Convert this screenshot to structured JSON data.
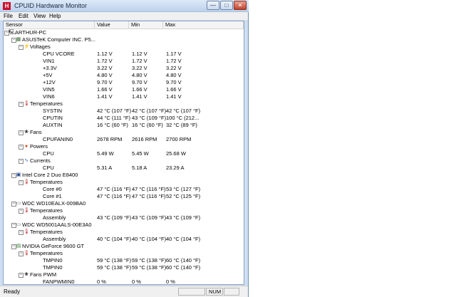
{
  "window": {
    "title": "CPUID Hardware Monitor",
    "app_icon": "H"
  },
  "menu": [
    "File",
    "Edit",
    "View",
    "Help"
  ],
  "columns": [
    "Sensor",
    "Value",
    "Min",
    "Max"
  ],
  "rows": [
    {
      "d": 0,
      "t": "pc",
      "l": "ARTHUR-PC",
      "v": "",
      "n": "",
      "x": ""
    },
    {
      "d": 1,
      "t": "mb",
      "l": "ASUSTeK Computer INC. P5...",
      "v": "",
      "n": "",
      "x": ""
    },
    {
      "d": 2,
      "t": "volt",
      "l": "Voltages",
      "v": "",
      "n": "",
      "x": ""
    },
    {
      "d": 3,
      "t": "",
      "l": "CPU VCORE",
      "v": "1.12 V",
      "n": "1.12 V",
      "x": "1.17 V"
    },
    {
      "d": 3,
      "t": "",
      "l": "VIN1",
      "v": "1.72 V",
      "n": "1.72 V",
      "x": "1.72 V"
    },
    {
      "d": 3,
      "t": "",
      "l": "+3.3V",
      "v": "3.22 V",
      "n": "3.22 V",
      "x": "3.22 V"
    },
    {
      "d": 3,
      "t": "",
      "l": "+5V",
      "v": "4.80 V",
      "n": "4.80 V",
      "x": "4.80 V"
    },
    {
      "d": 3,
      "t": "",
      "l": "+12V",
      "v": "9.70 V",
      "n": "9.70 V",
      "x": "9.70 V"
    },
    {
      "d": 3,
      "t": "",
      "l": "VIN5",
      "v": "1.66 V",
      "n": "1.66 V",
      "x": "1.66 V"
    },
    {
      "d": 3,
      "t": "",
      "l": "VIN6",
      "v": "1.41 V",
      "n": "1.41 V",
      "x": "1.41 V"
    },
    {
      "d": 2,
      "t": "temp",
      "l": "Temperatures",
      "v": "",
      "n": "",
      "x": ""
    },
    {
      "d": 3,
      "t": "",
      "l": "SYSTIN",
      "v": "42 °C  (107 °F)",
      "n": "42 °C  (107 °F)",
      "x": "42 °C  (107 °F)"
    },
    {
      "d": 3,
      "t": "",
      "l": "CPUTIN",
      "v": "44 °C  (111 °F)",
      "n": "43 °C  (109 °F)",
      "x": "100 °C  (212..."
    },
    {
      "d": 3,
      "t": "",
      "l": "AUXTIN",
      "v": "16 °C  (60 °F)",
      "n": "16 °C  (60 °F)",
      "x": "32 °C  (89 °F)"
    },
    {
      "d": 2,
      "t": "fan",
      "l": "Fans",
      "v": "",
      "n": "",
      "x": ""
    },
    {
      "d": 3,
      "t": "",
      "l": "CPUFANIN0",
      "v": "2678 RPM",
      "n": "2616 RPM",
      "x": "2700 RPM"
    },
    {
      "d": 2,
      "t": "power",
      "l": "Powers",
      "v": "",
      "n": "",
      "x": ""
    },
    {
      "d": 3,
      "t": "",
      "l": "CPU",
      "v": "5.49 W",
      "n": "5.45 W",
      "x": "25.68 W"
    },
    {
      "d": 2,
      "t": "curr",
      "l": "Currents",
      "v": "",
      "n": "",
      "x": ""
    },
    {
      "d": 3,
      "t": "",
      "l": "CPU",
      "v": "5.31 A",
      "n": "5.18 A",
      "x": "23.29 A"
    },
    {
      "d": 1,
      "t": "cpu",
      "l": "Intel Core 2 Duo E8400",
      "v": "",
      "n": "",
      "x": ""
    },
    {
      "d": 2,
      "t": "temp",
      "l": "Temperatures",
      "v": "",
      "n": "",
      "x": ""
    },
    {
      "d": 3,
      "t": "",
      "l": "Core #0",
      "v": "47 °C  (116 °F)",
      "n": "47 °C  (116 °F)",
      "x": "53 °C  (127 °F)"
    },
    {
      "d": 3,
      "t": "",
      "l": "Core #1",
      "v": "47 °C  (116 °F)",
      "n": "47 °C  (116 °F)",
      "x": "52 °C  (125 °F)"
    },
    {
      "d": 1,
      "t": "hdd",
      "l": "WDC WD10EALX-009BA0",
      "v": "",
      "n": "",
      "x": ""
    },
    {
      "d": 2,
      "t": "temp",
      "l": "Temperatures",
      "v": "",
      "n": "",
      "x": ""
    },
    {
      "d": 3,
      "t": "",
      "l": "Assembly",
      "v": "43 °C  (109 °F)",
      "n": "43 °C  (109 °F)",
      "x": "43 °C  (109 °F)"
    },
    {
      "d": 1,
      "t": "hdd",
      "l": "WDC WD5001AALS-00E3A0",
      "v": "",
      "n": "",
      "x": ""
    },
    {
      "d": 2,
      "t": "temp",
      "l": "Temperatures",
      "v": "",
      "n": "",
      "x": ""
    },
    {
      "d": 3,
      "t": "",
      "l": "Assembly",
      "v": "40 °C  (104 °F)",
      "n": "40 °C  (104 °F)",
      "x": "40 °C  (104 °F)"
    },
    {
      "d": 1,
      "t": "gpu",
      "l": "NVIDIA GeForce 9600 GT",
      "v": "",
      "n": "",
      "x": ""
    },
    {
      "d": 2,
      "t": "temp",
      "l": "Temperatures",
      "v": "",
      "n": "",
      "x": ""
    },
    {
      "d": 3,
      "t": "",
      "l": "TMPIN0",
      "v": "59 °C  (138 °F)",
      "n": "59 °C  (138 °F)",
      "x": "60 °C  (140 °F)"
    },
    {
      "d": 3,
      "t": "",
      "l": "TMPIN0",
      "v": "59 °C  (138 °F)",
      "n": "59 °C  (138 °F)",
      "x": "60 °C  (140 °F)"
    },
    {
      "d": 2,
      "t": "fan",
      "l": "Fans PWM",
      "v": "",
      "n": "",
      "x": ""
    },
    {
      "d": 3,
      "t": "",
      "l": "FANPWMIN0",
      "v": "0 %",
      "n": "0 %",
      "x": "0 %"
    }
  ],
  "status": {
    "text": "Ready",
    "indicator": "NUM"
  },
  "icons": {
    "pc": "computer-icon",
    "mb": "motherboard-icon",
    "volt": "voltage-icon",
    "temp": "thermometer-icon",
    "fan": "fan-icon",
    "power": "power-icon",
    "curr": "current-icon",
    "cpu": "cpu-chip-icon",
    "hdd": "hard-disk-icon",
    "gpu": "graphics-card-icon"
  }
}
